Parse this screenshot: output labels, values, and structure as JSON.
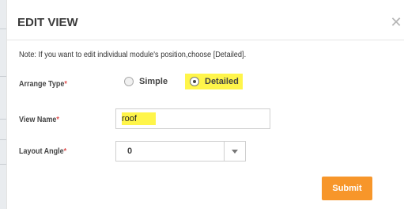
{
  "modal": {
    "title": "EDIT VIEW",
    "close_icon": "close-icon",
    "note": "Note: If you want to edit individual module's position,choose [Detailed]."
  },
  "form": {
    "arrange_type": {
      "label": "Arrange Type",
      "required_mark": "*",
      "options": [
        {
          "label": "Simple",
          "selected": false
        },
        {
          "label": "Detailed",
          "selected": true
        }
      ]
    },
    "view_name": {
      "label": "View Name",
      "required_mark": "*",
      "value": "roof"
    },
    "layout_angle": {
      "label": "Layout Angle",
      "required_mark": "*",
      "value": "0",
      "dropdown_icon": "chevron-down-icon"
    },
    "submit_label": "Submit"
  },
  "colors": {
    "accent": "#f7962a",
    "highlight": "#fff54a",
    "required": "#e05050"
  }
}
